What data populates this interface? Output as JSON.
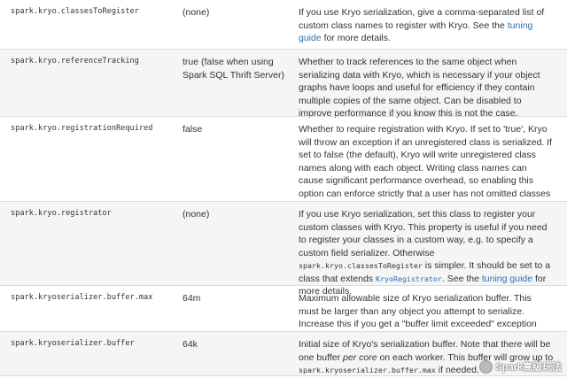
{
  "rows": [
    {
      "property": "spark.kryo.classesToRegister",
      "default": "(none)",
      "desc_pre": "If you use Kryo serialization, give a comma-separated list of custom class names to register with Kryo. See the ",
      "desc_link": "tuning guide",
      "desc_post": " for more details."
    },
    {
      "property": "spark.kryo.referenceTracking",
      "default": "true (false when using Spark SQL Thrift Server)",
      "desc": "Whether to track references to the same object when serializing data with Kryo, which is necessary if your object graphs have loops and useful for efficiency if they contain multiple copies of the same object. Can be disabled to improve performance if you know this is not the case."
    },
    {
      "property": "spark.kryo.registrationRequired",
      "default": "false",
      "desc": "Whether to require registration with Kryo. If set to 'true', Kryo will throw an exception if an unregistered class is serialized. If set to false (the default), Kryo will write unregistered class names along with each object. Writing class names can cause significant performance overhead, so enabling this option can enforce strictly that a user has not omitted classes from registration."
    },
    {
      "property": "spark.kryo.registrator",
      "default": "(none)",
      "desc_a": "If you use Kryo serialization, set this class to register your custom classes with Kryo. This property is useful if you need to register your classes in a custom way, e.g. to specify a custom field serializer. Otherwise ",
      "desc_code1": "spark.kryo.classesToRegister",
      "desc_b": " is simpler. It should be set to a class that extends ",
      "desc_code2": "KryoRegistrator",
      "desc_c": ". See the ",
      "desc_link": "tuning guide",
      "desc_d": " for more details."
    },
    {
      "property": "spark.kryoserializer.buffer.max",
      "default": "64m",
      "desc": "Maximum allowable size of Kryo serialization buffer. This must be larger than any object you attempt to serialize. Increase this if you get a \"buffer limit exceeded\" exception inside Kryo."
    },
    {
      "property": "spark.kryoserializer.buffer",
      "default": "64k",
      "desc_a": "Initial size of Kryo's serialization buffer. Note that there will be one buffer ",
      "desc_em": "per core",
      "desc_b": " on each worker. This buffer will grow up to ",
      "desc_code": "spark.kryoserializer.buffer.max",
      "desc_c": " if needed."
    }
  ],
  "watermark": "Spark高级玩法",
  "colors": {
    "link": "#2a6fb0",
    "border": "#dcdcdc",
    "shade": "#f5f5f5",
    "text": "#333333"
  }
}
